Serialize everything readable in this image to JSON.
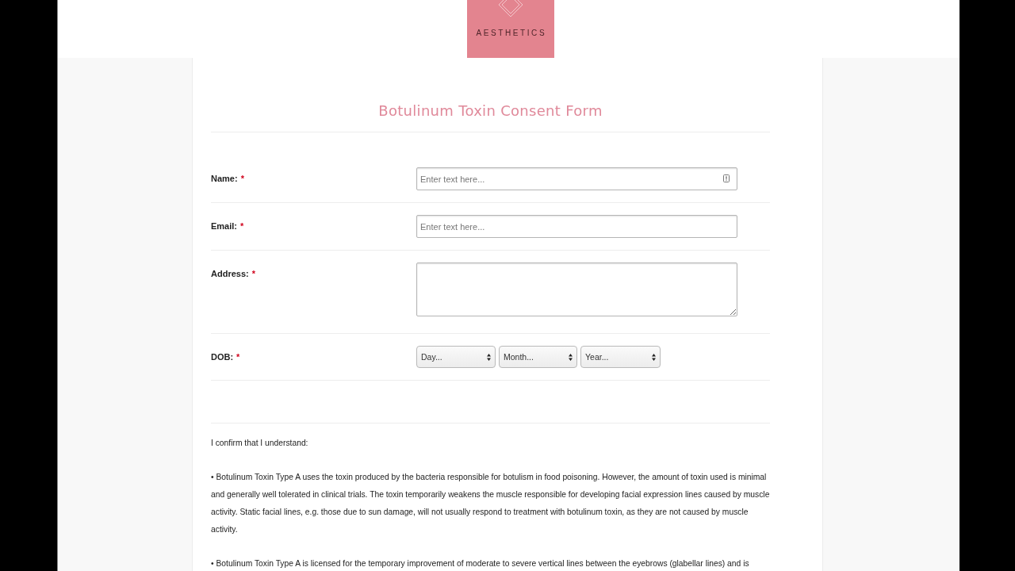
{
  "header": {
    "logo_text": "AESTHETICS"
  },
  "form": {
    "title": "Botulinum Toxin Consent Form",
    "fields": [
      {
        "kind": "text",
        "label": "Name:",
        "required_mark": "*",
        "placeholder": "Enter text here...",
        "autofill_icon": true
      },
      {
        "kind": "text",
        "label": "Email:",
        "required_mark": "*",
        "placeholder": "Enter text here..."
      },
      {
        "kind": "textarea",
        "label": "Address:",
        "required_mark": "*"
      },
      {
        "kind": "date",
        "label": "DOB:",
        "required_mark": "*",
        "selects": [
          {
            "value": "Day..."
          },
          {
            "value": "Month..."
          },
          {
            "value": "Year..."
          }
        ]
      }
    ]
  },
  "consent": {
    "intro": "I confirm that I understand:",
    "points": [
      "• Botulinum Toxin Type A uses the toxin produced by the bacteria responsible for botulism in food poisoning. However, the amount of toxin used is minimal and generally well tolerated in clinical trials. The toxin temporarily weakens the muscle responsible for developing facial expression lines caused by muscle activity. Static facial lines, e.g. those due to sun damage, will not usually respond to treatment with botulinum toxin, as they are not caused by muscle activity.",
      "• Botulinum Toxin Type A is licensed for the temporary improvement of moderate to severe vertical lines between the eyebrows (glabellar lines) and is"
    ]
  }
}
